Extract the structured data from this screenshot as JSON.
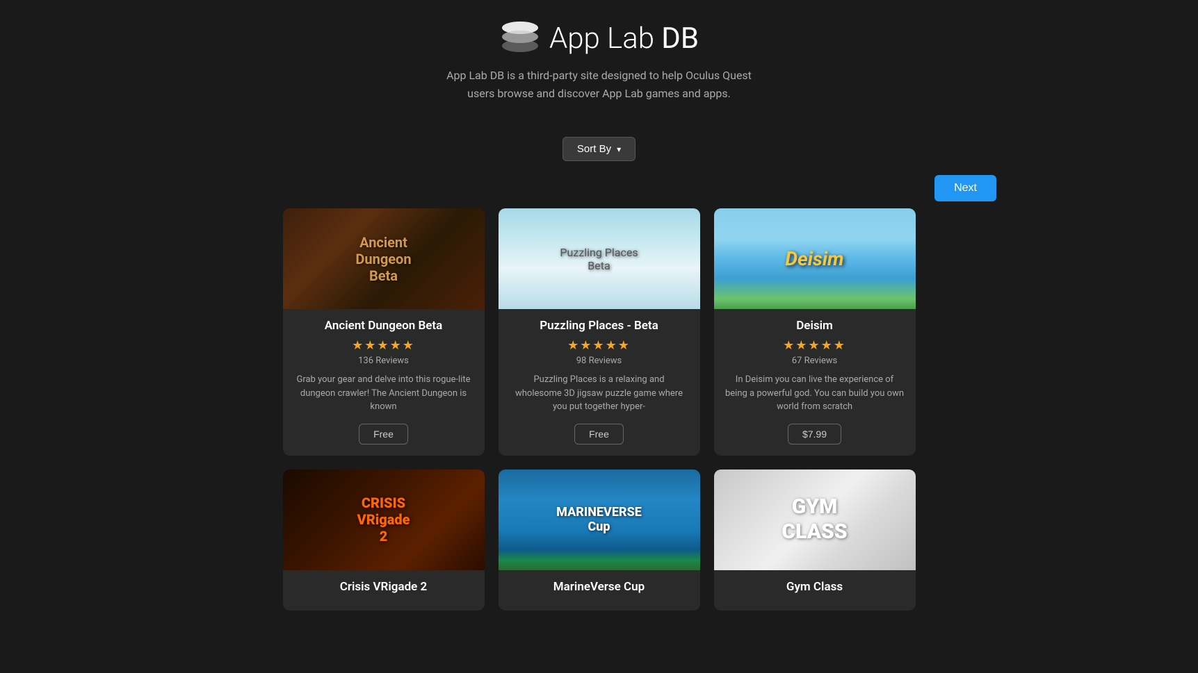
{
  "header": {
    "logo_text": "App Lab ",
    "logo_bold": "DB",
    "subtitle_line1": "App Lab DB is a third-party site designed to help Oculus Quest",
    "subtitle_line2": "users browse and discover App Lab games and apps."
  },
  "sort": {
    "label": "Sort By",
    "chevron": "▾"
  },
  "navigation": {
    "next_label": "Next"
  },
  "cards": [
    {
      "id": "ancient-dungeon-beta",
      "title": "Ancient Dungeon Beta",
      "stars": "★★★★★",
      "reviews": "136 Reviews",
      "description": "Grab your gear and delve into this rogue-lite dungeon crawler! The Ancient Dungeon is known",
      "price": "Free",
      "image_style": "ancient",
      "image_label": "Ancient\nDungeon\nBeta"
    },
    {
      "id": "puzzling-places-beta",
      "title": "Puzzling Places - Beta",
      "stars": "★★★★★",
      "reviews": "98 Reviews",
      "description": "Puzzling Places is a relaxing and wholesome 3D jigsaw puzzle game where you put together hyper-",
      "price": "Free",
      "image_style": "puzzling",
      "image_label": "Puzzling Places\nBeta"
    },
    {
      "id": "deisim",
      "title": "Deisim",
      "stars": "★★★★★",
      "reviews": "67 Reviews",
      "description": "In Deisim you can live the experience of being a powerful god. You can build you own world from scratch",
      "price": "$7.99",
      "image_style": "deisim",
      "image_label": "Deisim"
    },
    {
      "id": "crisis-vrigade-2",
      "title": "Crisis VRigade 2",
      "stars": "",
      "reviews": "",
      "description": "",
      "price": "",
      "image_style": "crisis",
      "image_label": "CRISIS\nVRigade\n2"
    },
    {
      "id": "marineverse-cup",
      "title": "MarineVerse Cup",
      "stars": "",
      "reviews": "",
      "description": "",
      "price": "",
      "image_style": "marineverse",
      "image_label": "MARINEVERSE\nCup"
    },
    {
      "id": "gym-class",
      "title": "Gym Class",
      "stars": "",
      "reviews": "",
      "description": "",
      "price": "",
      "image_style": "gymclass",
      "image_label": "GYM\nCLASS"
    }
  ]
}
